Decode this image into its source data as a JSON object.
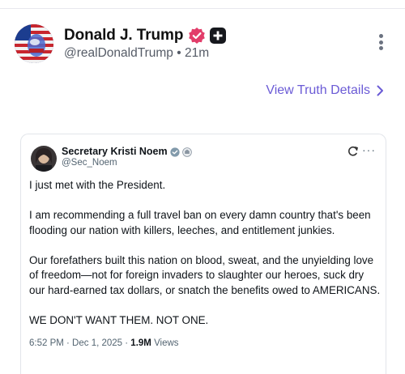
{
  "post": {
    "author_name": "Donald J. Trump",
    "handle": "@realDonaldTrump",
    "separator": "•",
    "time_ago": "21m",
    "details_link": "View Truth Details"
  },
  "embed": {
    "author_name": "Secretary Kristi Noem",
    "handle": "@Sec_Noem",
    "more_glyph": "···",
    "paragraphs": [
      "I just met with the President.",
      "I am recommending a full travel ban on every damn country that's been flooding our nation with killers, leeches, and entitlement junkies.",
      "Our forefathers built this nation on blood, sweat, and the unyielding love of freedom—not for foreign invaders to slaughter our heroes, suck dry our hard-earned tax dollars, or snatch the benefits owed to AMERICANS.",
      "WE DON'T WANT THEM. NOT ONE."
    ],
    "timestamp": "6:52 PM · Dec 1, 2025 · ",
    "views_count": "1.9M",
    "views_label": " Views"
  },
  "icons": [
    "avatar-portrait",
    "verified-badge-icon",
    "plus-badge-icon",
    "more-vertical-icon",
    "chevron-right-icon",
    "government-badge-icon",
    "refresh-icon"
  ],
  "colors": {
    "accent": "#6b5bd6",
    "verified": "#e23d6a",
    "muted": "#555b66"
  }
}
